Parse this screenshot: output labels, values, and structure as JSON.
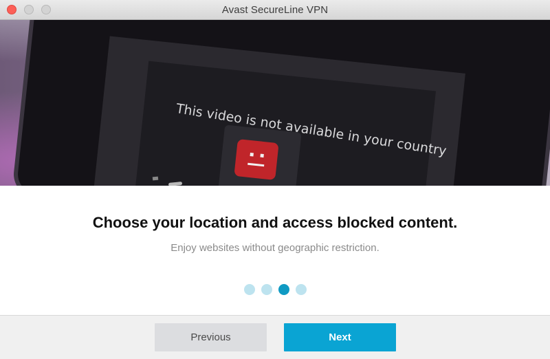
{
  "window": {
    "title": "Avast SecureLine VPN"
  },
  "hero": {
    "video_message": "This video is not available in your country"
  },
  "content": {
    "headline": "Choose your location and access blocked content.",
    "subline": "Enjoy websites without geographic restriction."
  },
  "pager": {
    "count": 4,
    "active_index": 2
  },
  "footer": {
    "previous_label": "Previous",
    "next_label": "Next"
  },
  "colors": {
    "accent": "#0aa4d3",
    "dot_active": "#0f9ac3",
    "dot_inactive": "#bde3ef",
    "close_button": "#fc5f57"
  }
}
